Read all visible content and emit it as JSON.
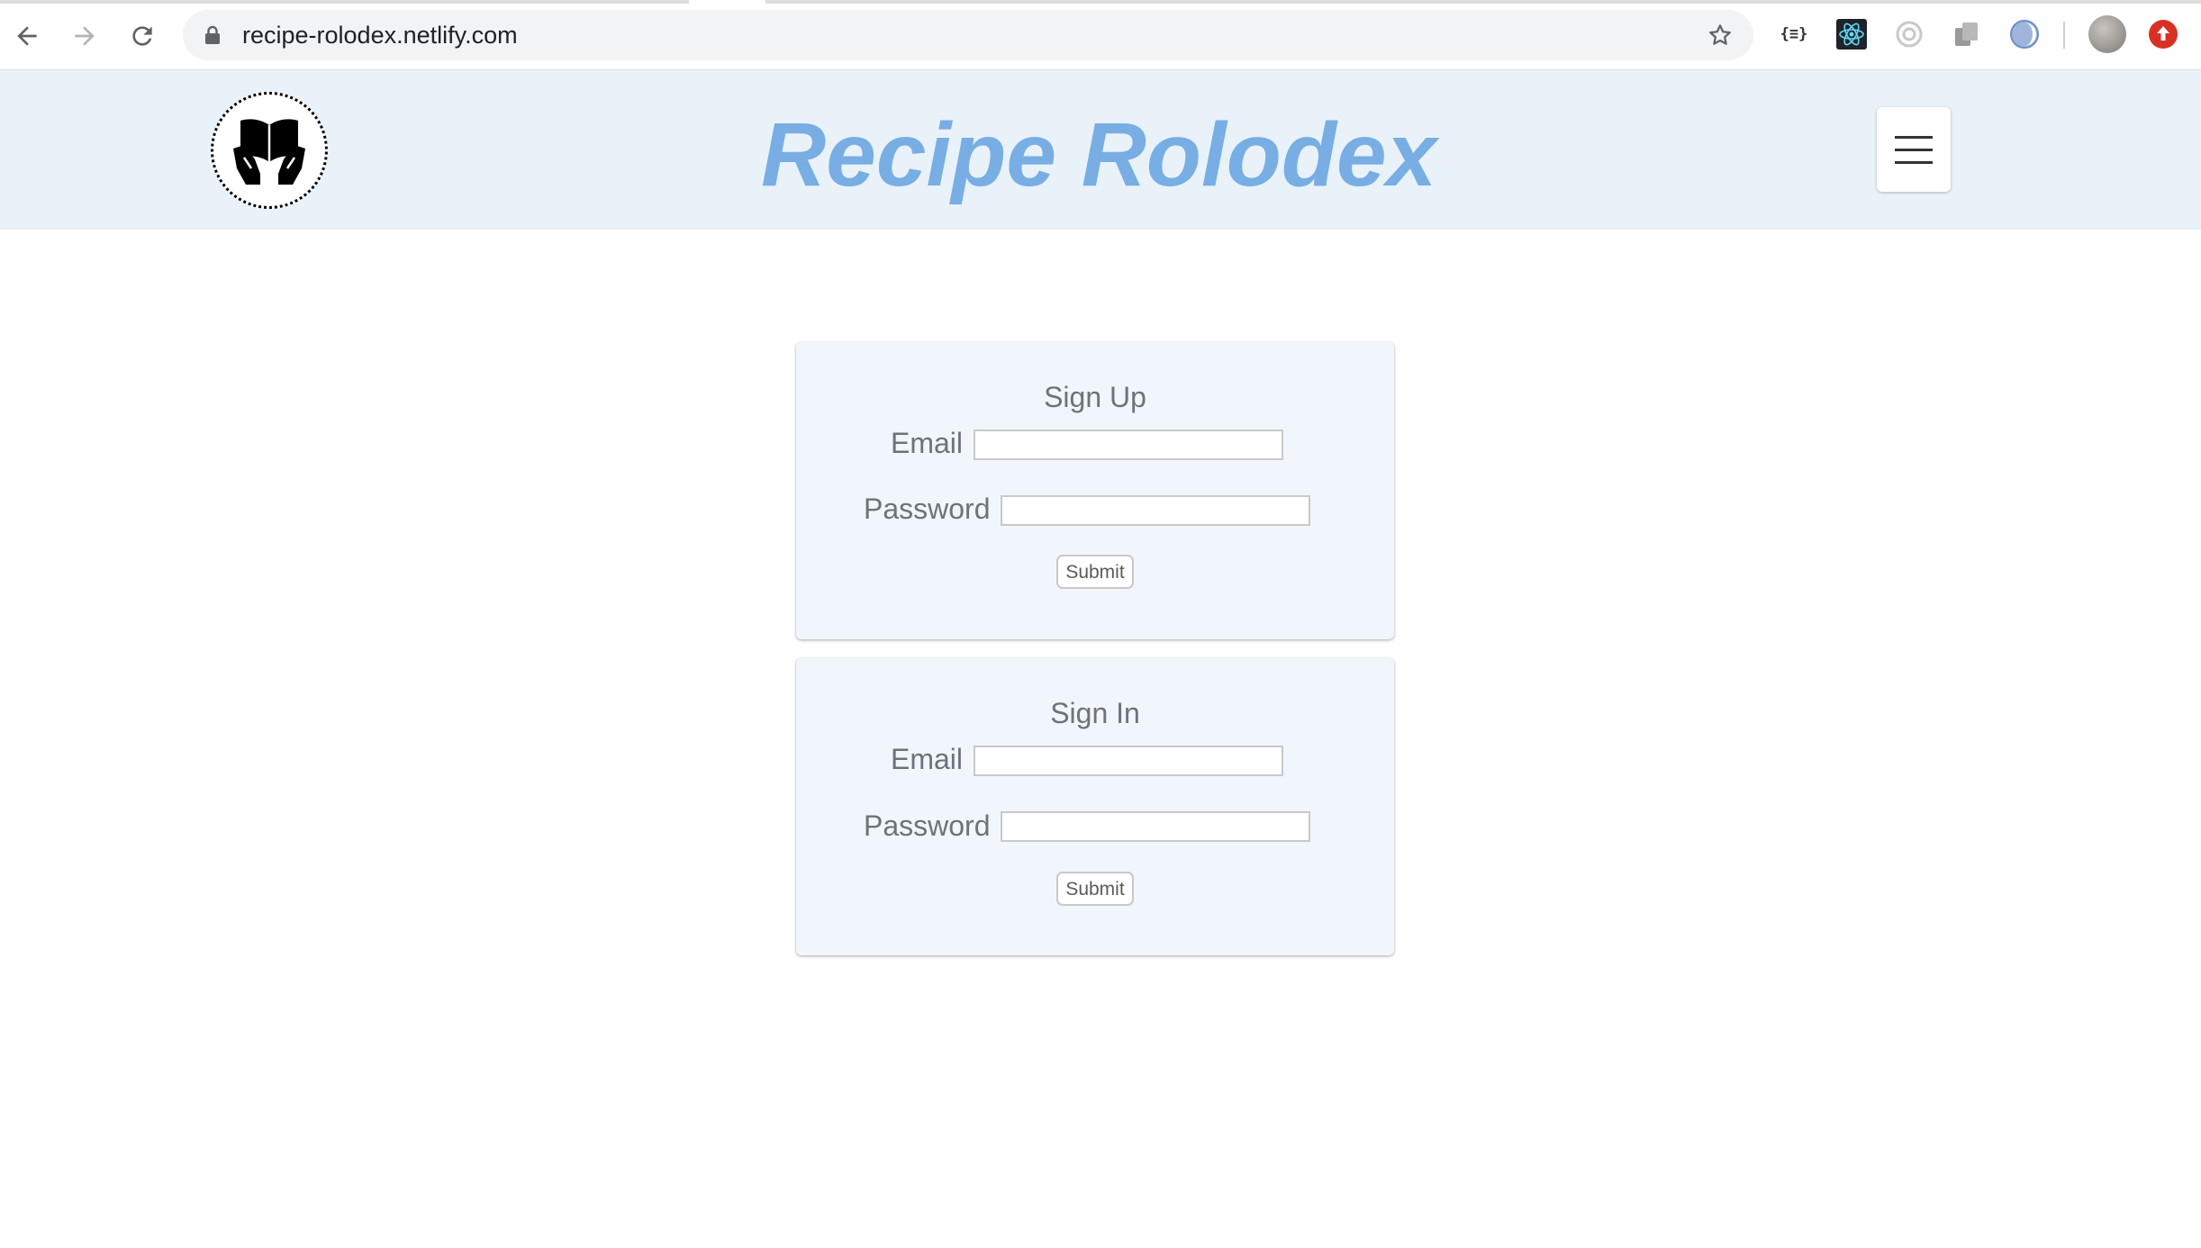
{
  "browser": {
    "url": "recipe-rolodex.netlify.com",
    "extensions": [
      "json-viewer-icon",
      "react-devtools-icon",
      "camera-extension-icon",
      "copy-extension-icon",
      "half-moon-extension-icon"
    ],
    "colors": {
      "omnibox": "#f1f3f4",
      "update_badge": "#d93025",
      "react_bg": "#20232a",
      "react_fg": "#61dafb"
    }
  },
  "header": {
    "title": "Recipe Rolodex",
    "title_color": "#78aee3",
    "background": "#e9f2f9"
  },
  "signup": {
    "title": "Sign Up",
    "email_label": "Email",
    "password_label": "Password",
    "email_value": "",
    "password_value": "",
    "submit_label": "Submit"
  },
  "signin": {
    "title": "Sign In",
    "email_label": "Email",
    "password_label": "Password",
    "email_value": "",
    "password_value": "",
    "submit_label": "Submit"
  }
}
